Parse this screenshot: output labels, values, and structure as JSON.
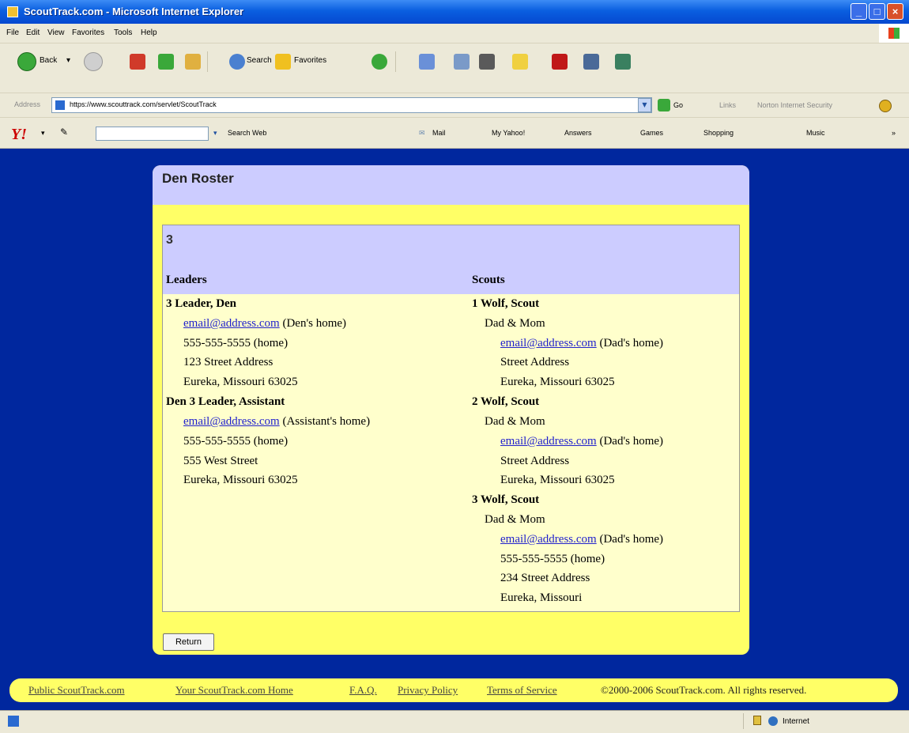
{
  "window": {
    "title": "ScoutTrack.com - Microsoft Internet Explorer"
  },
  "menu": [
    "File",
    "Edit",
    "View",
    "Favorites",
    "Tools",
    "Help"
  ],
  "toolbar": {
    "back": "Back",
    "search": "Search",
    "favorites": "Favorites"
  },
  "address": {
    "label": "Address",
    "url": "https://www.scouttrack.com/servlet/ScoutTrack",
    "go": "Go",
    "links": "Links",
    "norton": "Norton Internet Security"
  },
  "yahoo": {
    "search_web": "Search Web",
    "mail": "Mail",
    "my_yahoo": "My Yahoo!",
    "answers": "Answers",
    "games": "Games",
    "shopping": "Shopping",
    "music": "Music"
  },
  "panel": {
    "title": "Den Roster",
    "den_number": "3",
    "leaders_heading": "Leaders",
    "scouts_heading": "Scouts",
    "leaders": [
      {
        "name": "3 Leader, Den",
        "email": "email@address.com",
        "email_note": "(Den's home)",
        "phone": "555-555-5555",
        "phone_note": "(home)",
        "street": "123 Street Address",
        "city": "Eureka, Missouri  63025"
      },
      {
        "name": "Den 3 Leader, Assistant",
        "email": "email@address.com",
        "email_note": "(Assistant's home)",
        "phone": "555-555-5555",
        "phone_note": "(home)",
        "street": "555 West Street",
        "city": "Eureka, Missouri  63025"
      }
    ],
    "scouts": [
      {
        "name": "1 Wolf, Scout",
        "parents": "Dad & Mom",
        "email": "email@address.com",
        "email_note": "(Dad's home)",
        "street": "Street Address",
        "city": "Eureka, Missouri  63025"
      },
      {
        "name": "2 Wolf, Scout",
        "parents": "Dad & Mom",
        "email": "email@address.com",
        "email_note": "(Dad's home)",
        "street": "Street Address",
        "city": "Eureka, Missouri  63025"
      },
      {
        "name": "3 Wolf, Scout",
        "parents": "Dad & Mom",
        "email": "email@address.com",
        "email_note": "(Dad's home)",
        "phone": "555-555-5555",
        "phone_note": "(home)",
        "street": "234 Street Address",
        "city": "Eureka, Missouri"
      }
    ],
    "return_label": "Return"
  },
  "footer": {
    "links": [
      "Public ScoutTrack.com",
      "Your ScoutTrack.com Home",
      "F.A.Q.",
      "Privacy Policy",
      "Terms of Service"
    ],
    "copyright": "©2000-2006 ScoutTrack.com. All rights reserved."
  },
  "status": {
    "zone": "Internet"
  },
  "colors": {
    "page_bg": "#00279e",
    "panel": "#ffff66",
    "header": "#ccccff",
    "content": "#ffffcc",
    "link": "#2222cc"
  }
}
